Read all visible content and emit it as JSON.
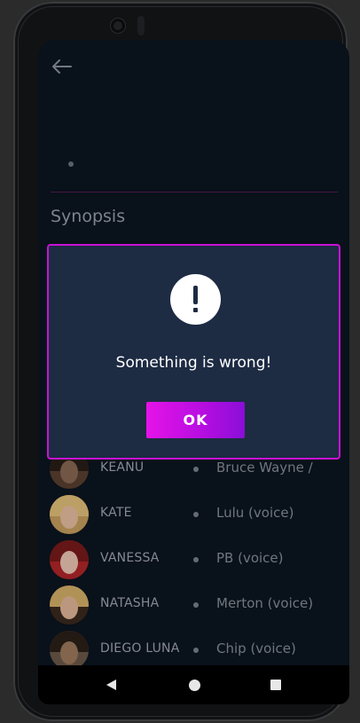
{
  "header": {
    "back_icon": "arrow-left-icon"
  },
  "section": {
    "synopsis_label": "Synopsis"
  },
  "cast": [
    {
      "actor": "KEANU",
      "role": "Bruce Wayne /"
    },
    {
      "actor": "KATE",
      "role": "Lulu (voice)"
    },
    {
      "actor": "VANESSA",
      "role": "PB (voice)"
    },
    {
      "actor": "NATASHA",
      "role": "Merton (voice)"
    },
    {
      "actor": "DIEGO LUNA",
      "role": "Chip (voice)"
    }
  ],
  "dialog": {
    "icon": "exclamation-icon",
    "message": "Something is wrong!",
    "ok_label": "OK"
  },
  "colors": {
    "accent": "#c912d6",
    "dialog_bg": "#1d2b43",
    "screen_bg": "#0b1520"
  }
}
